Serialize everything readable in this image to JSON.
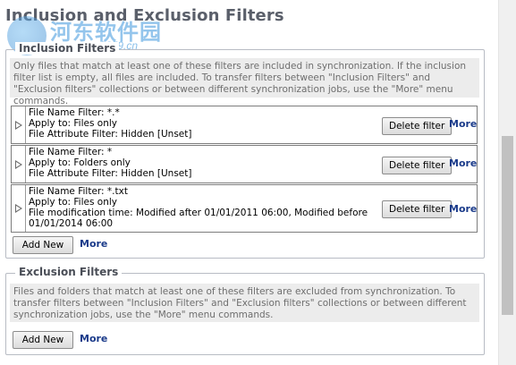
{
  "page": {
    "title": "Inclusion and Exclusion Filters"
  },
  "watermark": {
    "text": "河东软件园",
    "url": "www.pc0359.cn"
  },
  "inclusion": {
    "legend": "Inclusion Filters",
    "description": "Only files that match at least one of these filters are included in synchronization. If the inclusion filter list is empty, all files are included. To transfer filters between \"Inclusion Filters\" and \"Exclusion filters\" collections or between different synchronization jobs, use the \"More\" menu commands.",
    "filters": [
      {
        "lines": [
          "File Name Filter: *.*",
          "Apply to: Files only",
          "File Attribute Filter: Hidden [Unset]"
        ]
      },
      {
        "lines": [
          "File Name Filter: *",
          "Apply to: Folders only",
          "File Attribute Filter: Hidden [Unset]"
        ]
      },
      {
        "lines": [
          "File Name Filter: *.txt",
          "Apply to: Files only",
          "File modification time: Modified after 01/01/2011 06:00, Modified before",
          "01/01/2014 06:00"
        ]
      }
    ],
    "delete_label": "Delete filter",
    "more_label": "More",
    "add_new_label": "Add New"
  },
  "exclusion": {
    "legend": "Exclusion Filters",
    "description": "Files and folders that match at least one of these filters are excluded from synchronization. To transfer filters between \"Inclusion Filters\" and \"Exclusion filters\" collections or between different synchronization jobs, use the \"More\" menu commands.",
    "add_new_label": "Add New",
    "more_label": "More"
  },
  "colors": {
    "link": "#1b3b8a",
    "description_bg": "#ececec",
    "title": "#5a5f6a"
  }
}
